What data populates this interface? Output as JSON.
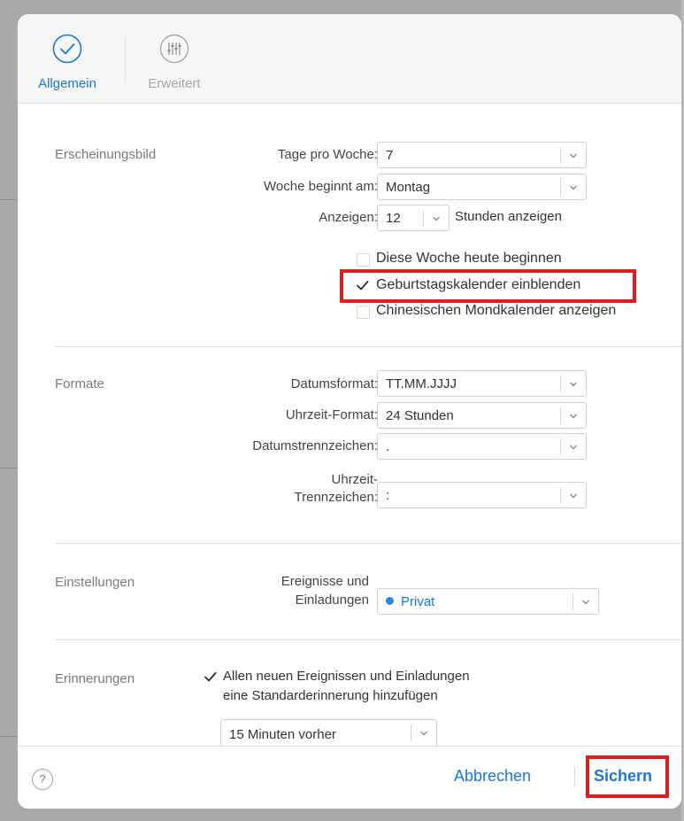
{
  "tabs": {
    "general": {
      "label": "Allgemein",
      "icon": "checkmark-circle-icon",
      "color": "#1a79d8"
    },
    "advanced": {
      "label": "Erweitert",
      "icon": "sliders-icon"
    }
  },
  "appearance": {
    "title": "Erscheinungsbild",
    "days_per_week": {
      "label": "Tage pro Woche:",
      "value": "7"
    },
    "week_starts": {
      "label": "Woche beginnt am:",
      "value": "Montag"
    },
    "display": {
      "label": "Anzeigen:",
      "value": "12",
      "suffix": "Stunden anzeigen"
    },
    "checkboxes": [
      {
        "label": "Diese Woche heute beginnen",
        "checked": false
      },
      {
        "label": "Geburtstagskalender einblenden",
        "checked": true,
        "highlighted": true
      },
      {
        "label": "Chinesischen Mondkalender anzeigen",
        "checked": false
      }
    ]
  },
  "formats": {
    "title": "Formate",
    "date_format": {
      "label": "Datumsformat:",
      "value": "TT.MM.JJJJ"
    },
    "time_format": {
      "label": "Uhrzeit-Format:",
      "value": "24 Stunden"
    },
    "date_separator": {
      "label": "Datumstrennzeichen:",
      "value": "."
    },
    "time_separator": {
      "label_line1": "Uhrzeit-",
      "label_line2": "Trennzeichen:",
      "value": ":"
    }
  },
  "settings": {
    "title": "Einstellungen",
    "events": {
      "label_line1": "Ereignisse und",
      "label_line2": "Einladungen",
      "value": "Privat",
      "dot_color": "#2a8ad8"
    }
  },
  "reminders": {
    "title": "Erinnerungen",
    "default_reminder": {
      "checked": true,
      "label_line1": "Allen neuen Ereignissen und Einladungen",
      "label_line2": "eine Standarderinnerung hinzufügen"
    },
    "reminder_time": {
      "value": "15 Minuten vorher"
    }
  },
  "footer": {
    "help": "?",
    "cancel": "Abbrechen",
    "save": "Sichern",
    "save_highlighted": true
  },
  "colors": {
    "accent": "#1a79d8",
    "highlight": "#e31c1c"
  }
}
